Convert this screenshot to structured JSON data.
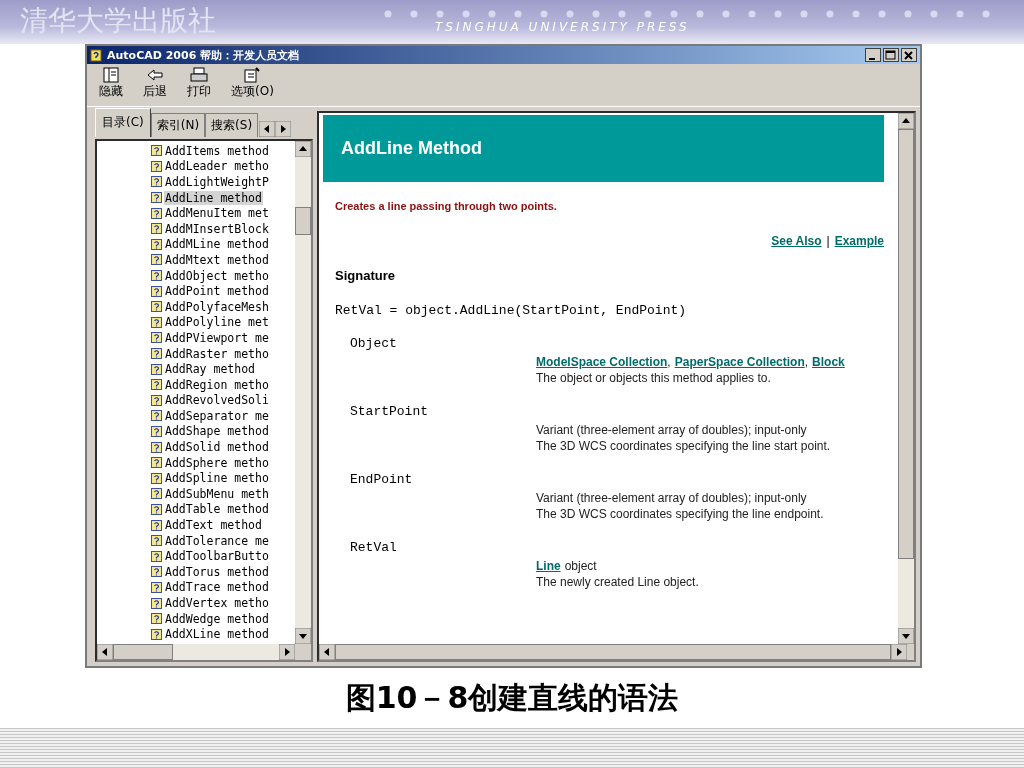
{
  "slide": {
    "publisher": "清华大学出版社",
    "publisher_en": "TSINGHUA UNIVERSITY PRESS",
    "caption": "图10－8创建直线的语法"
  },
  "window": {
    "title": "AutoCAD 2006 帮助：开发人员文档"
  },
  "toolbar": [
    {
      "label": "隐藏",
      "kind": "hide"
    },
    {
      "label": "后退",
      "kind": "back"
    },
    {
      "label": "打印",
      "kind": "print"
    },
    {
      "label": "选项(O)",
      "kind": "options"
    }
  ],
  "tabs": [
    {
      "label": "目录(C)",
      "selected": true
    },
    {
      "label": "索引(N)",
      "selected": false
    },
    {
      "label": "搜索(S)",
      "selected": false
    }
  ],
  "tree": {
    "items": [
      {
        "label": "AddItems method",
        "selected": false
      },
      {
        "label": "AddLeader metho",
        "selected": false
      },
      {
        "label": "AddLightWeightP",
        "selected": false
      },
      {
        "label": "AddLine method",
        "selected": true
      },
      {
        "label": "AddMenuItem met",
        "selected": false
      },
      {
        "label": "AddMInsertBlock",
        "selected": false
      },
      {
        "label": "AddMLine method",
        "selected": false
      },
      {
        "label": "AddMtext method",
        "selected": false
      },
      {
        "label": "AddObject metho",
        "selected": false
      },
      {
        "label": "AddPoint method",
        "selected": false
      },
      {
        "label": "AddPolyfaceMesh",
        "selected": false
      },
      {
        "label": "AddPolyline met",
        "selected": false
      },
      {
        "label": "AddPViewport me",
        "selected": false
      },
      {
        "label": "AddRaster metho",
        "selected": false
      },
      {
        "label": "AddRay method",
        "selected": false
      },
      {
        "label": "AddRegion metho",
        "selected": false
      },
      {
        "label": "AddRevolvedSoli",
        "selected": false
      },
      {
        "label": "AddSeparator me",
        "selected": false
      },
      {
        "label": "AddShape method",
        "selected": false
      },
      {
        "label": "AddSolid method",
        "selected": false
      },
      {
        "label": "AddSphere metho",
        "selected": false
      },
      {
        "label": "AddSpline metho",
        "selected": false
      },
      {
        "label": "AddSubMenu meth",
        "selected": false
      },
      {
        "label": "AddTable method",
        "selected": false
      },
      {
        "label": "AddText method",
        "selected": false
      },
      {
        "label": "AddTolerance me",
        "selected": false
      },
      {
        "label": "AddToolbarButto",
        "selected": false
      },
      {
        "label": "AddTorus method",
        "selected": false
      },
      {
        "label": "AddTrace method",
        "selected": false
      },
      {
        "label": "AddVertex metho",
        "selected": false
      },
      {
        "label": "AddWedge method",
        "selected": false
      },
      {
        "label": "AddXLine method",
        "selected": false
      }
    ]
  },
  "topic": {
    "title": "AddLine Method",
    "summary": "Creates a line passing through two points.",
    "links": [
      "See Also",
      "Example"
    ],
    "link_separator": "|",
    "section": "Signature",
    "syntax": "RetVal = object.AddLine(StartPoint, EndPoint)",
    "parameters": [
      {
        "name": "Object",
        "type_links": [
          "ModelSpace Collection",
          "PaperSpace Collection",
          "Block"
        ],
        "type_separator": ",",
        "description": "The object or objects this method applies to."
      },
      {
        "name": "StartPoint",
        "type_text": "Variant (three-element array of doubles); input-only",
        "description": "The 3D WCS coordinates specifying the line start point."
      },
      {
        "name": "EndPoint",
        "type_text": "Variant (three-element array of doubles); input-only",
        "description": "The 3D WCS coordinates specifying the line endpoint."
      },
      {
        "name": "RetVal",
        "type_links": [
          "Line"
        ],
        "type_text": "object",
        "description": "The newly created Line object."
      }
    ]
  }
}
